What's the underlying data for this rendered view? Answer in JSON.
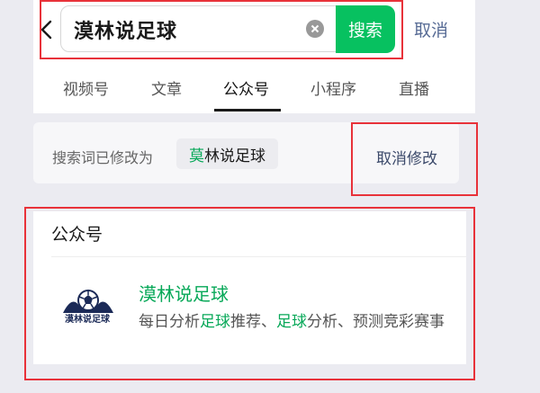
{
  "search": {
    "query": "漠林说足球",
    "button_label": "搜索",
    "cancel_label": "取消"
  },
  "tabs": [
    {
      "label": "视频号",
      "active": false
    },
    {
      "label": "文章",
      "active": false
    },
    {
      "label": "公众号",
      "active": true
    },
    {
      "label": "小程序",
      "active": false
    },
    {
      "label": "直播",
      "active": false
    }
  ],
  "correction": {
    "label": "搜索词已修改为",
    "chip_hl": "莫",
    "chip_rest": "林说足球",
    "undo_label": "取消修改"
  },
  "results": {
    "section_title": "公众号",
    "account": {
      "logo_text": "漠林说足球",
      "name": "漠林说足球",
      "desc_parts": [
        "每日分析",
        "足球",
        "推荐、",
        "足球",
        "分析、预测竞彩赛事"
      ]
    }
  },
  "colors": {
    "accent": "#07c160",
    "highlight": "#07a858",
    "link": "#576b95",
    "annotation": "#e8323a"
  },
  "icons": [
    "back-chevron-icon",
    "clear-icon",
    "football-logo-icon"
  ]
}
